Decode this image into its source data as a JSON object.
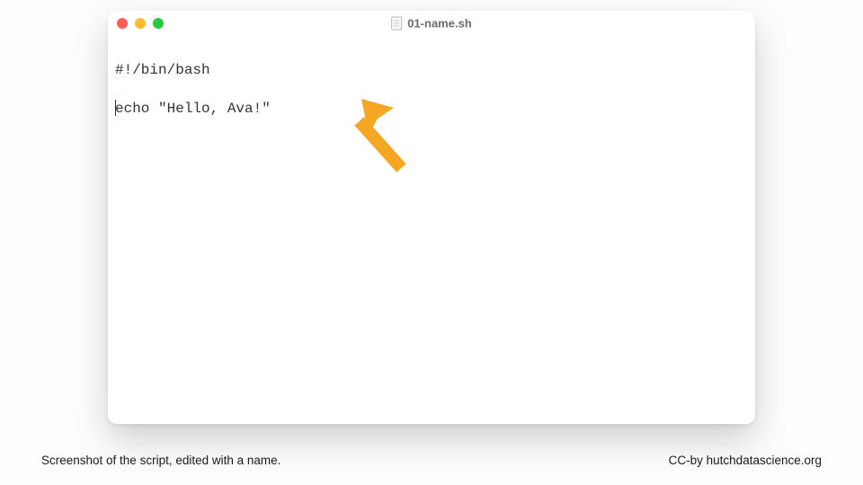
{
  "window": {
    "filename": "01-name.sh",
    "colors": {
      "close": "#ff5f57",
      "minimize": "#febc2e",
      "maximize": "#28c840"
    }
  },
  "editor": {
    "line1": "#!/bin/bash",
    "blank": "",
    "line2": "echo \"Hello, Ava!\""
  },
  "annotation": {
    "arrow_color": "#f5a623"
  },
  "footer": {
    "caption": "Screenshot of the script, edited with a name.",
    "attribution": "CC-by hutchdatascience.org"
  }
}
